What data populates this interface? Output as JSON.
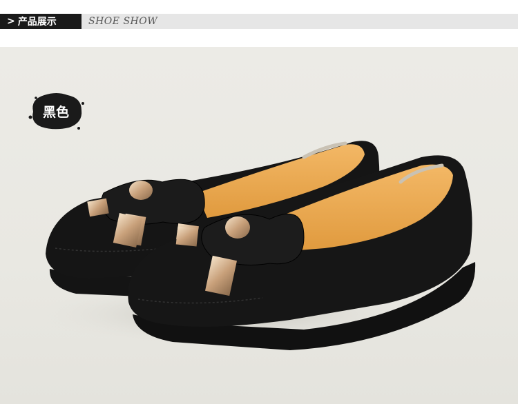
{
  "header": {
    "arrow": ">",
    "label_cn": "产品展示",
    "label_en": "SHOE SHOW"
  },
  "product": {
    "color_label": "黑色",
    "item": "black suede loafer pair with bow and gold metal accents"
  }
}
